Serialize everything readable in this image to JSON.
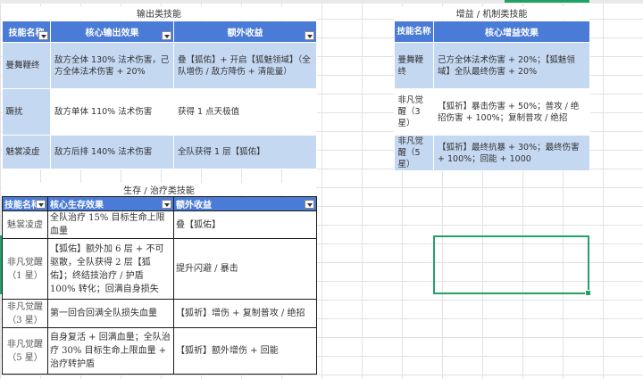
{
  "sections": {
    "output_title": "输出类技能",
    "buff_title": "增益 / 机制类技能",
    "survival_title": "生存 / 治疗类技能"
  },
  "output_table": {
    "headers": [
      "技能名称",
      "核心输出效果",
      "额外收益"
    ],
    "rows": [
      [
        "曼舞鞭终",
        "敌方全体 130% 法术伤害，己方全体法术伤害 + 20%",
        "叠【狐佑】+ 开启【狐魅领域】（全队增伤 / 敌方降伤 + 清能量）"
      ],
      [
        "蹶扰",
        "敌方单体 110% 法术伤害",
        "获得 1 点天极值"
      ],
      [
        "魅裳凌虚",
        "敌方后排 140% 法术伤害",
        "全队获得 1 层【狐佑】"
      ]
    ]
  },
  "buff_table": {
    "headers": [
      "技能名称",
      "核心增益效果"
    ],
    "rows": [
      [
        "曼舞鞭终",
        "己方全体法术伤害 + 20%；【狐魅领域】全队最终伤害 + 20%"
      ],
      [
        "非凡觉醒（3 星）",
        "【狐祈】暴击伤害 + 50%；普攻 / 绝招伤害 + 100%；复制普攻 / 绝招"
      ],
      [
        "非凡觉醒（5 星）",
        "【狐祈】最终抗暴 + 30%；最终伤害 + 100%；回能 + 1000"
      ]
    ]
  },
  "survival_table": {
    "headers": [
      "技能名称",
      "核心生存效果",
      "额外收益"
    ],
    "rows": [
      [
        "魅裳凌虚",
        "全队治疗 15% 目标生命上限血量",
        "叠【狐佑】"
      ],
      [
        "非凡觉醒（1 星）",
        "【狐佑】额外加 6 层 + 不可驱散，全队获得 2 层【狐佑】；终结技治疗 / 护盾 100% 转化；回满自身损失",
        "提升闪避 / 暴击"
      ],
      [
        "非凡觉醒（3 星）",
        "第一回合回满全队损失血量",
        "【狐祈】增伤 + 复制普攻 / 绝招"
      ],
      [
        "非凡觉醒（5 星）",
        "自身复活 + 回满血量；全队治疗 30% 目标生命上限血量 + 治疗转护盾",
        "【狐祈】额外增伤 + 回能"
      ]
    ]
  }
}
